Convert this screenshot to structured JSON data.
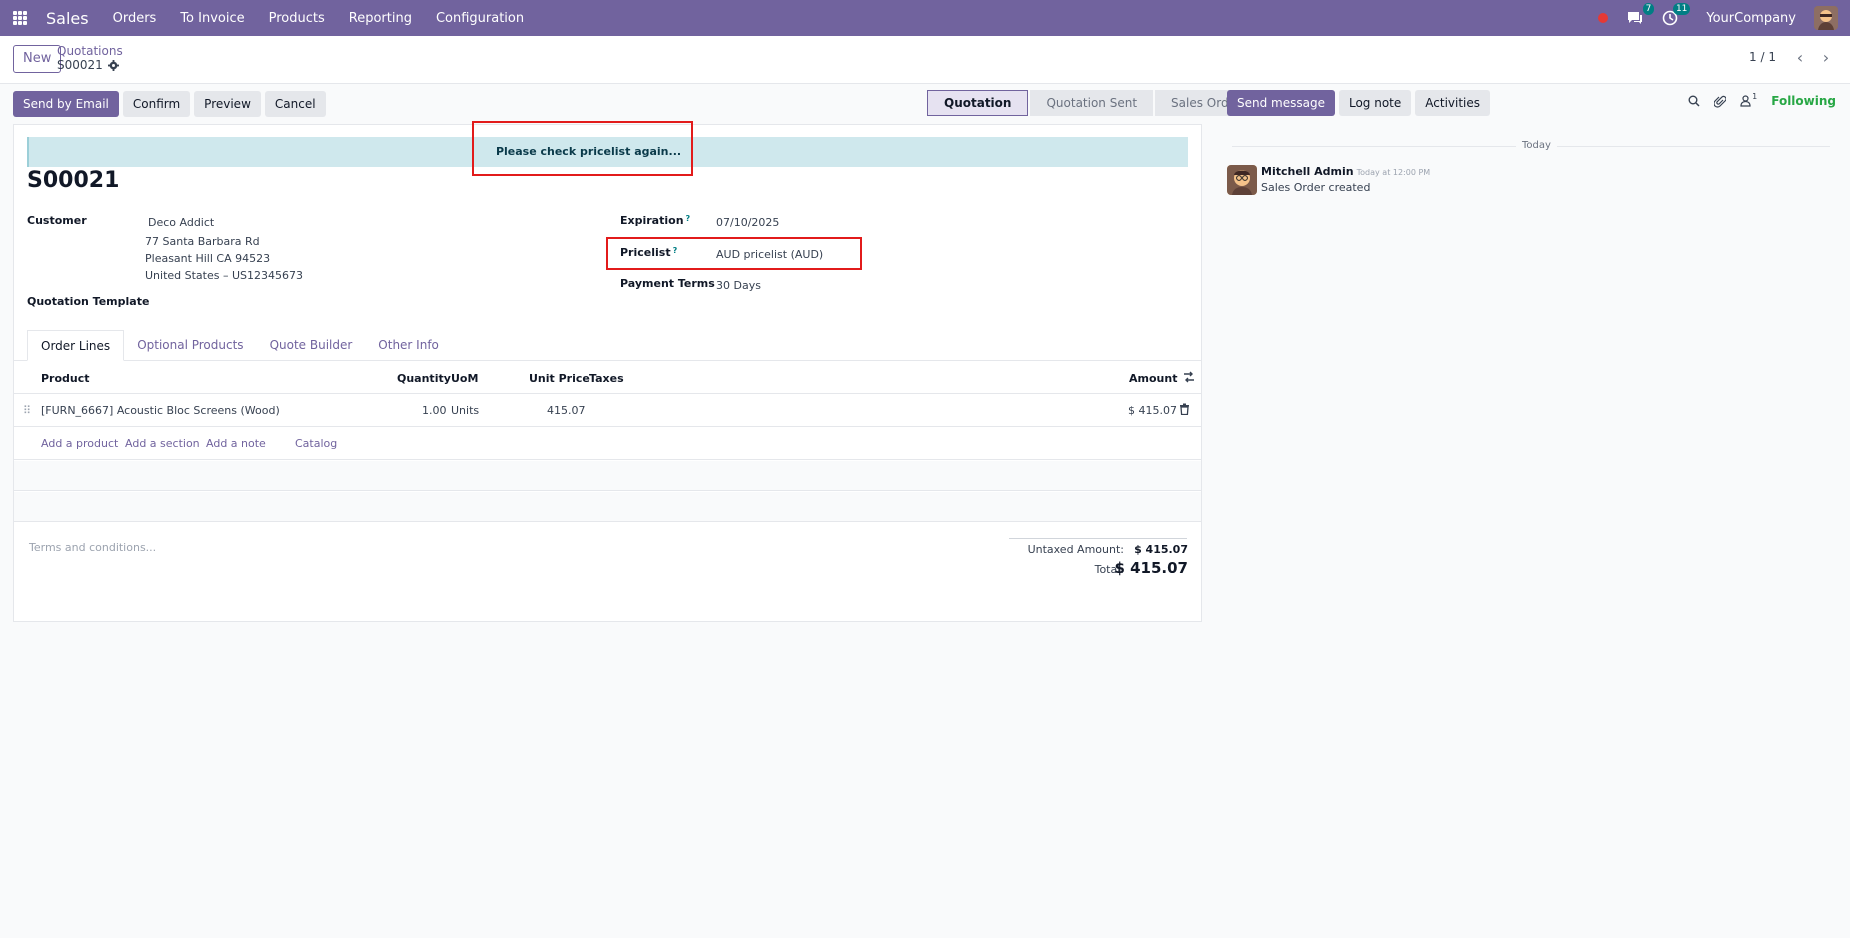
{
  "navbar": {
    "app_name": "Sales",
    "menu": [
      "Orders",
      "To Invoice",
      "Products",
      "Reporting",
      "Configuration"
    ],
    "messages_count": "7",
    "activities_count": "11",
    "company": "YourCompany"
  },
  "control": {
    "new_label": "New",
    "breadcrumb_parent": "Quotations",
    "breadcrumb_current": "S00021",
    "pager": "1 / 1"
  },
  "actions": {
    "send_email": "Send by Email",
    "confirm": "Confirm",
    "preview": "Preview",
    "cancel": "Cancel"
  },
  "status": {
    "stages": [
      "Quotation",
      "Quotation Sent",
      "Sales Order"
    ],
    "active": "Quotation"
  },
  "form": {
    "alert": "Please check pricelist again...",
    "title": "S00021",
    "customer_label": "Customer",
    "customer_name": "Deco Addict",
    "customer_addr1": "77 Santa Barbara Rd",
    "customer_addr2": "Pleasant Hill CA 94523",
    "customer_addr3": "United States – US12345673",
    "template_label": "Quotation Template",
    "expiration_label": "Expiration",
    "expiration_value": "07/10/2025",
    "pricelist_label": "Pricelist",
    "pricelist_value": "AUD pricelist (AUD)",
    "payment_label": "Payment Terms",
    "payment_value": "30 Days",
    "help_mark": "?"
  },
  "tabs": [
    "Order Lines",
    "Optional Products",
    "Quote Builder",
    "Other Info"
  ],
  "table": {
    "headers": {
      "product": "Product",
      "quantity": "Quantity",
      "uom": "UoM",
      "unit_price": "Unit Price",
      "taxes": "Taxes",
      "amount": "Amount"
    },
    "rows": [
      {
        "product": "[FURN_6667] Acoustic Bloc Screens (Wood)",
        "quantity": "1.00",
        "uom": "Units",
        "unit_price": "415.07",
        "taxes": "",
        "amount": "$ 415.07"
      }
    ],
    "add_product": "Add a product",
    "add_section": "Add a section",
    "add_note": "Add a note",
    "catalog": "Catalog"
  },
  "footer": {
    "terms_placeholder": "Terms and conditions...",
    "untaxed_label": "Untaxed Amount:",
    "untaxed_value": "$ 415.07",
    "total_label": "Total:",
    "total_value": "$ 415.07"
  },
  "chatter": {
    "send_message": "Send message",
    "log_note": "Log note",
    "activities": "Activities",
    "followers_count": "1",
    "following": "Following",
    "today": "Today",
    "author": "Mitchell Admin",
    "time": "Today at 12:00 PM",
    "body": "Sales Order created"
  },
  "colors": {
    "brand": "#71639e",
    "highlight": "#e21b1b",
    "alert_bg": "#cfe8ed",
    "following": "#28a745"
  }
}
